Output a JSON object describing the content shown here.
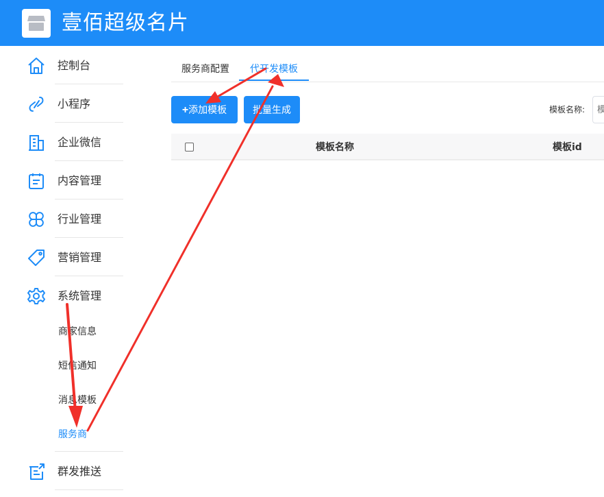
{
  "app": {
    "title": "壹佰超级名片",
    "logo_icon": "store-icon"
  },
  "colors": {
    "primary": "#1d8cf8",
    "annotation": "#f0302a"
  },
  "sidebar": {
    "items": [
      {
        "label": "控制台",
        "icon": "home-icon"
      },
      {
        "label": "小程序",
        "icon": "link-icon"
      },
      {
        "label": "企业微信",
        "icon": "building-icon"
      },
      {
        "label": "内容管理",
        "icon": "clipboard-icon"
      },
      {
        "label": "行业管理",
        "icon": "clover-icon"
      },
      {
        "label": "营销管理",
        "icon": "tag-icon"
      },
      {
        "label": "系统管理",
        "icon": "gear-icon"
      },
      {
        "label": "群发推送",
        "icon": "broadcast-icon"
      }
    ],
    "sub_items": [
      {
        "label": "商家信息"
      },
      {
        "label": "短信通知"
      },
      {
        "label": "消息模板"
      },
      {
        "label": "服务商",
        "active": true
      }
    ]
  },
  "tabs": [
    {
      "label": "服务商配置",
      "active": false
    },
    {
      "label": "代开发模板",
      "active": true
    }
  ],
  "toolbar": {
    "add_label": "添加模板",
    "batch_label": "批量生成",
    "search_label": "模板名称:",
    "search_placeholder": "模"
  },
  "table": {
    "columns": [
      "模板名称",
      "模板id"
    ],
    "rows": []
  }
}
